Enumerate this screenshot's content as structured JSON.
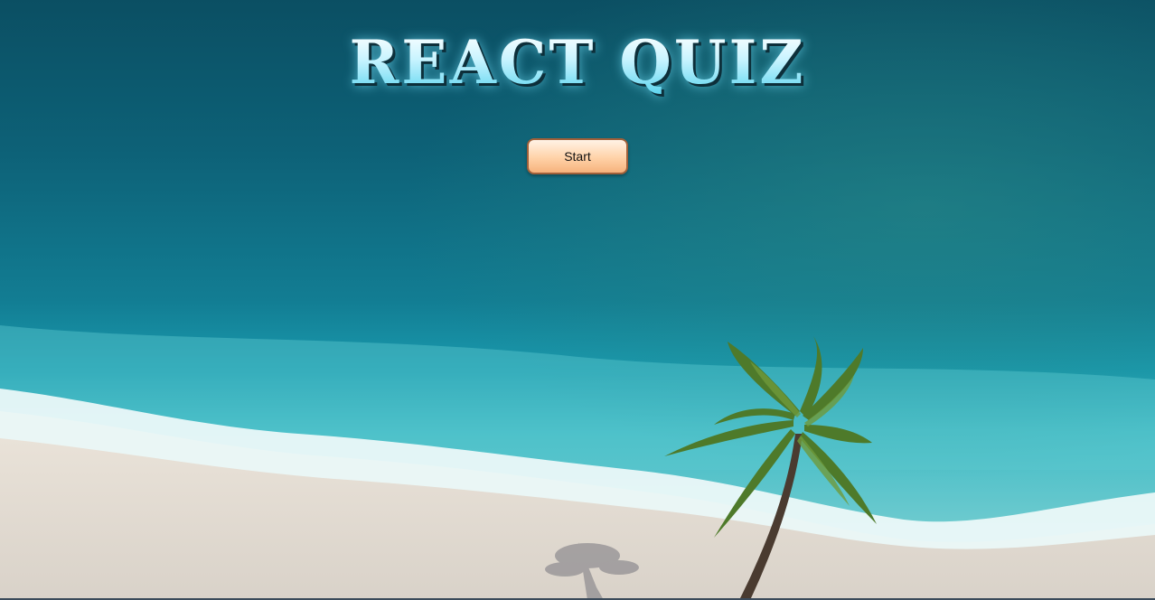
{
  "quiz": {
    "title": "REACT QUIZ",
    "start_label": "Start"
  },
  "colors": {
    "ocean_deep": "#0b5468",
    "ocean_mid": "#1687a0",
    "lagoon": "#2fb3c4",
    "sand": "#e3dcd2",
    "button_fill": "#ffd2a8",
    "button_border": "#a0603a",
    "title_fill": "#c9f4ff"
  },
  "icons": {
    "palm": "palm-tree-icon"
  }
}
